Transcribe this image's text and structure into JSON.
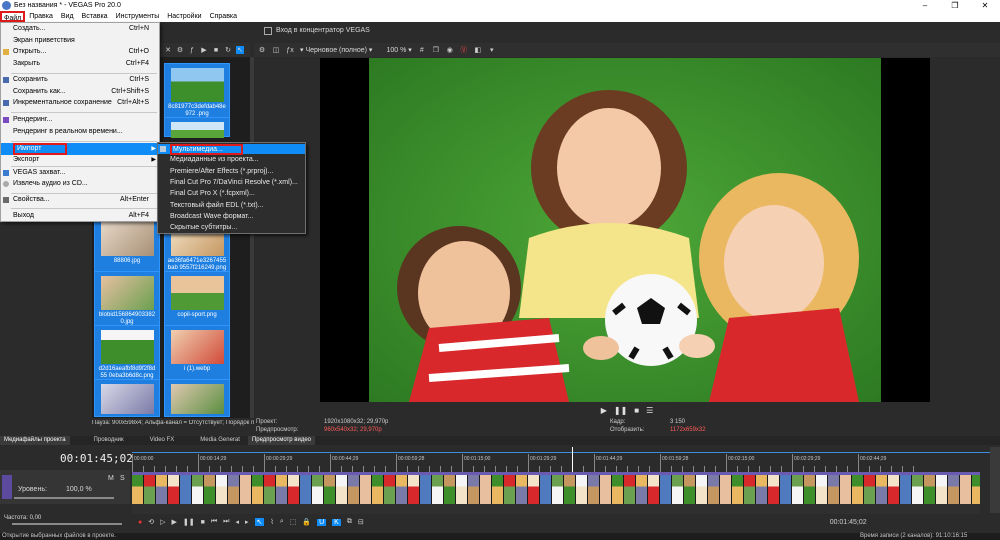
{
  "window": {
    "title": "Без названия * - VEGAS Pro 20.0",
    "minimize": "–",
    "maximize": "❐",
    "close": "✕"
  },
  "menubar": [
    "Файл",
    "Правка",
    "Вид",
    "Вставка",
    "Инструменты",
    "Настройки",
    "Справка"
  ],
  "file_menu": [
    {
      "label": "Создать...",
      "shortcut": "Ctrl+N"
    },
    {
      "label": "Экран приветствия",
      "shortcut": ""
    },
    {
      "label": "Открыть...",
      "shortcut": "Ctrl+O"
    },
    {
      "label": "Закрыть",
      "shortcut": "Ctrl+F4"
    },
    {
      "label": "Сохранить",
      "shortcut": "Ctrl+S"
    },
    {
      "label": "Сохранить как...",
      "shortcut": "Ctrl+Shift+S"
    },
    {
      "label": "Инкрементальное сохранение",
      "shortcut": "Ctrl+Alt+S"
    },
    {
      "label": "Рендеринг...",
      "shortcut": ""
    },
    {
      "label": "Рендеринг в реальном времени...",
      "shortcut": ""
    },
    {
      "label": "Импорт",
      "shortcut": ""
    },
    {
      "label": "Экспорт",
      "shortcut": ""
    },
    {
      "label": "VEGAS захват...",
      "shortcut": ""
    },
    {
      "label": "Извлечь аудио из CD...",
      "shortcut": ""
    },
    {
      "label": "Свойства...",
      "shortcut": "Alt+Enter"
    },
    {
      "label": "Выход",
      "shortcut": "Alt+F4"
    }
  ],
  "import_menu": [
    "Мультимедиа...",
    "Медиаданные из проекта...",
    "Premiere/After Effects (*.prproj)...",
    "Final Cut Pro 7/DaVinci Resolve (*.xml)...",
    "Final Cut Pro X (*.fcpxml)...",
    "Текстовый файл EDL (*.txt)...",
    "Broadcast Wave формат...",
    "Скрытые субтитры..."
  ],
  "media": {
    "items": [
      {
        "caption": "8c81977c3defdab48e972 .png"
      },
      {
        "caption": ""
      },
      {
        "caption": "88806.jpg"
      },
      {
        "caption": "ae36fa6471e3267455bab 9557f216249.png"
      },
      {
        "caption": "blobid15686490338​20.jpg"
      },
      {
        "caption": "copil-sport.png"
      },
      {
        "caption": "d2d16aeafbf8d9f2f8d55 0eba3b6d8c.png"
      },
      {
        "caption": "i (1).webp"
      },
      {
        "caption": ""
      },
      {
        "caption": ""
      }
    ],
    "status": "Пауза: 900x598x4; Альфа-канал = Отсутствует; Порядок п..."
  },
  "preview": {
    "header": "Вход в концентратор VEGAS",
    "quality": "Черновое (полное)",
    "zoom": "100 %",
    "project_label": "Проект:",
    "project_value": "1920x1080x32; 29,970p",
    "preview_label": "Предпросмотр:",
    "preview_value": "960x540x32; 29,970p",
    "frame_label": "Кадр:",
    "frame_value": "3 150",
    "display_label": "Отобразить:",
    "display_value": "1172x659x32"
  },
  "dock_tabs": [
    "Медиафайлы проекта",
    "Проводник",
    "Video FX",
    "Media Generat",
    "Предпросмотр видео"
  ],
  "timeline": {
    "timecode": "00:01:45;02",
    "track_level_label": "Уровень:",
    "track_level_value": "100,0 %",
    "m_label": "M",
    "s_label": "S",
    "rate_label": "Частота: 0,00",
    "ruler_marks": [
      "00:00:00",
      "00:00:14;29",
      "00:00:29;29",
      "00:00:44;29",
      "00:00:59;28",
      "00:01:15;00",
      "00:01:29;29",
      "00:01:44;29",
      "00:01:59;28",
      "00:02:15;00",
      "00:02:29;29",
      "00:02:44;29"
    ],
    "end_time": "00:01:45;02"
  },
  "statusbar": {
    "left": "Открытие выбранных файлов в проекте.",
    "right": "Время записи (2 каналов): 91:10:16:15"
  },
  "colors": {
    "accent": "#0f8cf5",
    "media_tile": "#1f7fe0",
    "highlight_border": "#e01a1a"
  }
}
